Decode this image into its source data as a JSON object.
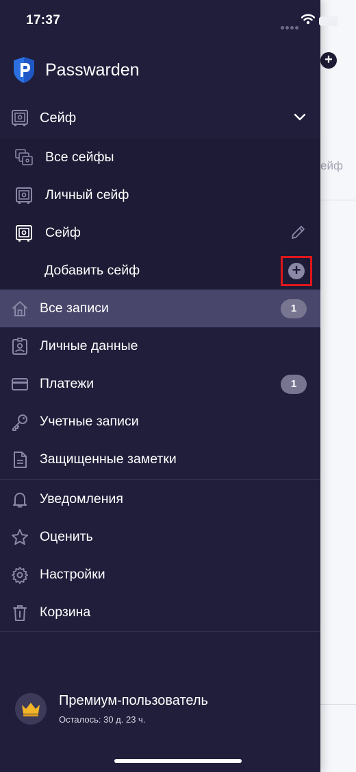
{
  "status_bar": {
    "time": "17:37"
  },
  "app": {
    "name": "Passwarden"
  },
  "vault_selector": {
    "label": "Сейф"
  },
  "vault_list": {
    "all_vaults": "Все сейфы",
    "personal_vault": "Личный сейф",
    "current_vault": "Сейф",
    "add_vault": "Добавить сейф"
  },
  "nav": {
    "all_records": {
      "label": "Все записи",
      "count": "1"
    },
    "personal_data": {
      "label": "Личные данные"
    },
    "payments": {
      "label": "Платежи",
      "count": "1"
    },
    "accounts": {
      "label": "Учетные записи"
    },
    "secure_notes": {
      "label": "Защищенные заметки"
    },
    "notifications": {
      "label": "Уведомления"
    },
    "rate": {
      "label": "Оценить"
    },
    "settings": {
      "label": "Настройки"
    },
    "trash": {
      "label": "Корзина"
    }
  },
  "premium": {
    "title": "Премиум-пользователь",
    "remaining": "Осталось: 30 д. 23 ч."
  },
  "background_app": {
    "partial_text": "ейф",
    "add_symbol": "+"
  },
  "colors": {
    "drawer_bg": "#201e3b",
    "sub_panel_bg": "#1d1b35",
    "active_item_bg": "#48466a",
    "badge_bg": "#777590",
    "highlight_border": "#e0161c",
    "logo_blue": "#2b6fe0"
  }
}
